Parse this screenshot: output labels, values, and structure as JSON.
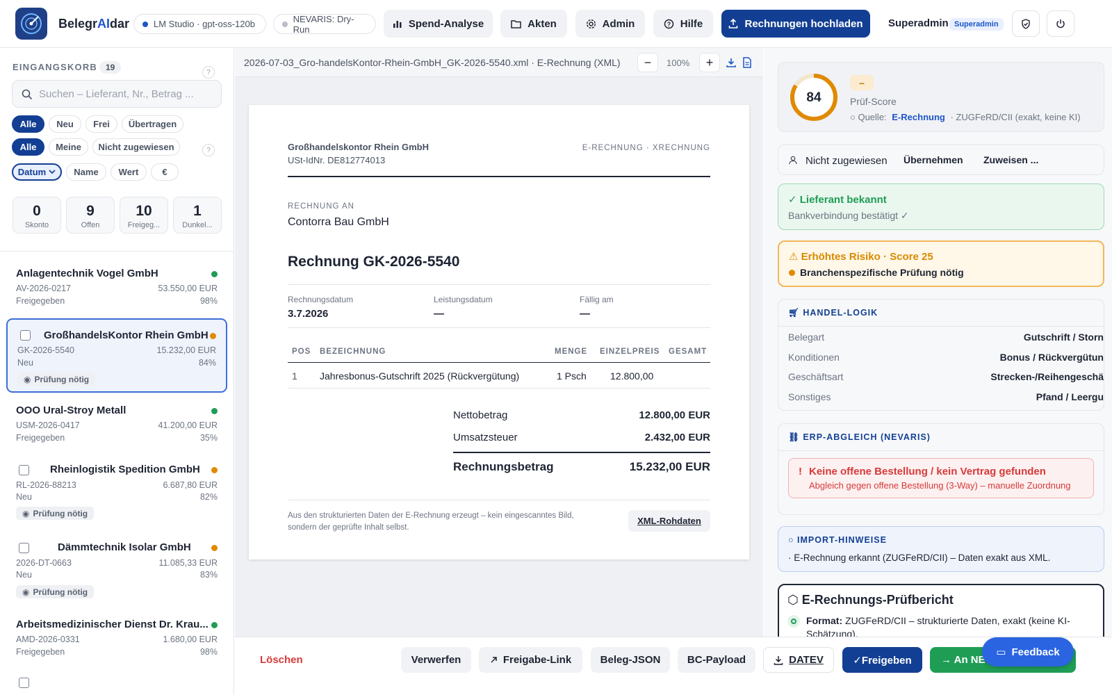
{
  "topbar": {
    "brand_prefix": "Belegr",
    "brand_ai": "AI",
    "brand_suffix": "dar",
    "model_pill": "LM Studio · gpt-oss-120b",
    "nevaris_pill": "NEVARIS: Dry-Run",
    "nav": [
      "Spend-Analyse",
      "Akten",
      "Admin",
      "Hilfe"
    ],
    "upload": "Rechnungen hochladen",
    "user": "Superadmin",
    "role": "Superadmin"
  },
  "inbox": {
    "title": "EINGANGSKORB",
    "count": "19",
    "search_placeholder": "Suchen – Lieferant, Nr., Betrag ...",
    "filter_status": [
      "Alle",
      "Neu",
      "Frei",
      "Übertragen"
    ],
    "filter_assign": [
      "Alle",
      "Meine",
      "Nicht zugewiesen"
    ],
    "sort": [
      "Datum",
      "Name",
      "Wert",
      "€"
    ],
    "stats": [
      {
        "n": "0",
        "l": "Skonto"
      },
      {
        "n": "9",
        "l": "Offen"
      },
      {
        "n": "10",
        "l": "Freigeg..."
      },
      {
        "n": "1",
        "l": "Dunkel..."
      }
    ],
    "items": [
      {
        "name": "Anlagentechnik Vogel GmbH",
        "id": "AV-2026-0217",
        "amount": "53.550,00 EUR",
        "status": "Freigegeben",
        "pct": "98%",
        "dot": "#1f9d55"
      },
      {
        "name": "GroßhandelsKontor Rhein GmbH",
        "id": "GK-2026-5540",
        "amount": "15.232,00 EUR",
        "status": "Neu",
        "pct": "84%",
        "tag": "Prüfung nötig",
        "dot": "#e08a00"
      },
      {
        "name": "OOO Ural-Stroy Metall",
        "id": "USM-2026-0417",
        "amount": "41.200,00 EUR",
        "status": "Freigegeben",
        "pct": "35%",
        "dot": "#1f9d55"
      },
      {
        "name": "Rheinlogistik Spedition GmbH",
        "id": "RL-2026-88213",
        "amount": "6.687,80 EUR",
        "status": "Neu",
        "pct": "82%",
        "tag": "Prüfung nötig",
        "dot": "#e08a00"
      },
      {
        "name": "Dämmtechnik Isolar GmbH",
        "id": "2026-DT-0663",
        "amount": "11.085,33 EUR",
        "status": "Neu",
        "pct": "83%",
        "tag": "Prüfung nötig",
        "dot": "#e08a00"
      },
      {
        "name": "Arbeitsmedizinischer Dienst Dr. Krau...",
        "id": "AMD-2026-0331",
        "amount": "1.680,00 EUR",
        "status": "Freigegeben",
        "pct": "98%",
        "dot": "#1f9d55"
      }
    ]
  },
  "doc": {
    "filename": "2026-07-03_Gro-handelsKontor-Rhein-GmbH_GK-2026-5540.xml · E-Rechnung (XML)",
    "zoom": "100%",
    "seller": "Großhandelskontor Rhein GmbH",
    "vat_id": "USt-IdNr. DE812774013",
    "doc_type": "E-RECHNUNG · XRECHNUNG",
    "bill_to_label": "RECHNUNG AN",
    "bill_to": "Contorra Bau GmbH",
    "title": "Rechnung GK-2026-5540",
    "dates": [
      {
        "label": "Rechnungsdatum",
        "value": "3.7.2026"
      },
      {
        "label": "Leistungsdatum",
        "value": "—"
      },
      {
        "label": "Fällig am",
        "value": "—"
      }
    ],
    "columns": [
      "POS",
      "BEZEICHNUNG",
      "MENGE",
      "EINZELPREIS",
      "GESAMT"
    ],
    "lines": [
      {
        "pos": "1",
        "desc": "Jahresbonus-Gutschrift 2025 (Rückvergütung)",
        "qty": "1 Psch",
        "price": "12.800,00",
        "total": ""
      }
    ],
    "net_label": "Nettobetrag",
    "net": "12.800,00 EUR",
    "vat_label": "Umsatzsteuer",
    "vat": "2.432,00 EUR",
    "gross_label": "Rechnungsbetrag",
    "gross": "15.232,00 EUR",
    "footnote_1": "Aus den strukturierten Daten der E-Rechnung erzeugt – kein eingescanntes Bild,",
    "footnote_2": "sondern der geprüfte Inhalt selbst.",
    "xml_link": "XML-Rohdaten"
  },
  "actions": {
    "delete": "Löschen",
    "discard": "Verwerfen",
    "share": "Freigabe-Link",
    "json": "Beleg-JSON",
    "bc": "BC-Payload",
    "datev": "DATEV",
    "approve": "✓Freigeben",
    "to_nevaris": "→ An NE",
    "feedback": "Feedback"
  },
  "panel": {
    "score": 84,
    "score_pct": 0.84,
    "score_badge": "–",
    "score_label": "Prüf-Score",
    "source_label": "Quelle:",
    "source_value": "E-Rechnung",
    "source_detail": "· ZUGFeRD/CII (exakt, keine KI)",
    "assign_label": "Nicht zugewiesen",
    "take": "Übernehmen",
    "assign": "Zuweisen ...",
    "vendor_title": "✓ Lieferant bekannt",
    "vendor_sub": "Bankverbindung bestätigt ✓",
    "risk_title": "Erhöhtes Risiko · Score 25",
    "risk_sub": "Branchenspezifische Prüfung nötig",
    "trade_title": "HANDEL-LOGIK",
    "trade_rows": [
      {
        "k": "Belegart",
        "v": "Gutschrift / Storn"
      },
      {
        "k": "Konditionen",
        "v": "Bonus / Rückvergütun"
      },
      {
        "k": "Geschäftsart",
        "v": "Strecken-/Reihengeschä"
      },
      {
        "k": "Sonstiges",
        "v": "Pfand / Leergu"
      }
    ],
    "erp_title": "ERP-ABGLEICH (NEVARIS)",
    "erp_err_title": "Keine offene Bestellung / kein Vertrag gefunden",
    "erp_err_sub": "Abgleich gegen offene Bestellung (3-Way) – manuelle Zuordnung",
    "import_title": "IMPORT-HINWEISE",
    "import_text": "· E-Rechnung erkannt (ZUGFeRD/CII) – Daten exakt aus XML.",
    "report_title": "E-Rechnungs-Prüfbericht",
    "report_format_label": "Format:",
    "report_format_text": "ZUGFeRD/CII – strukturierte Daten, exakt (keine KI-",
    "report_format_text2": "Schätzung)."
  }
}
